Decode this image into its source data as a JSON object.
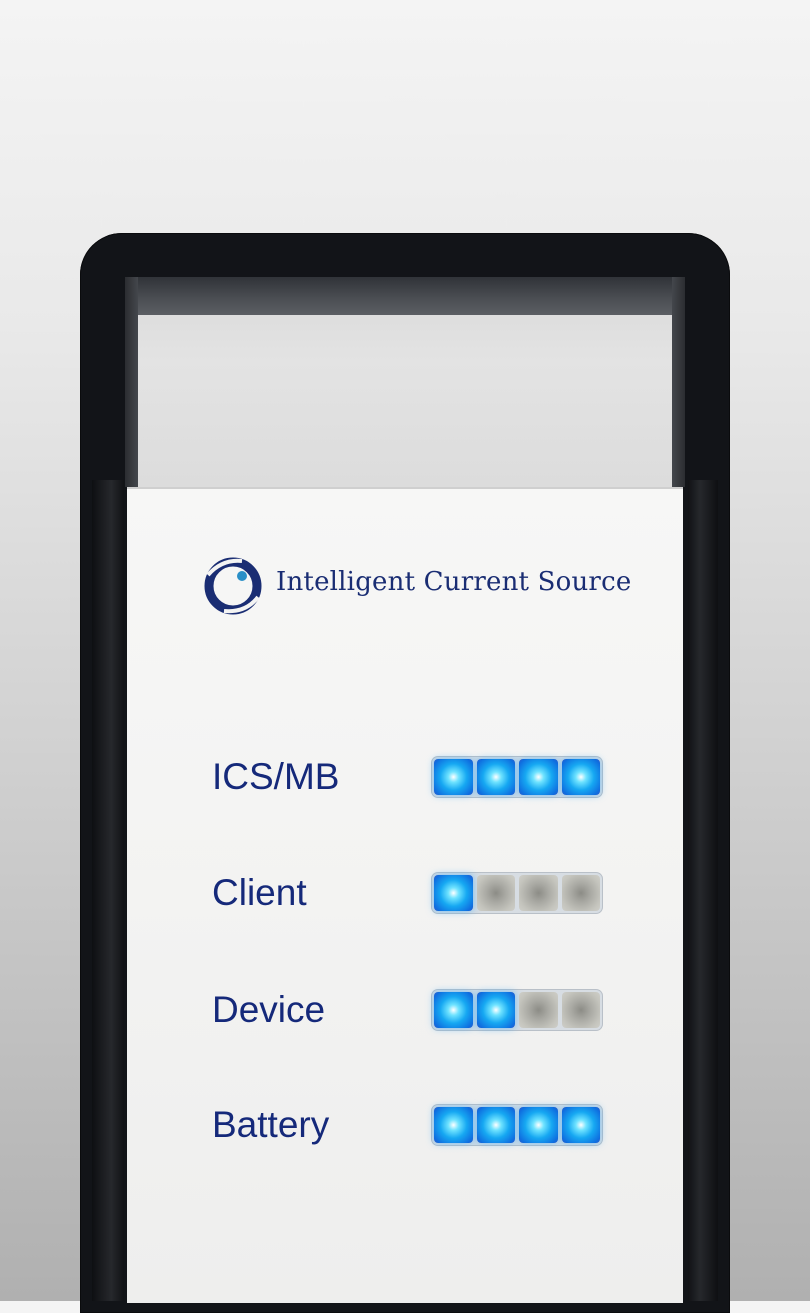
{
  "brand": {
    "name": "Intelligent Current Source",
    "logo": "ics-ring-logo"
  },
  "colors": {
    "brand_blue": "#1a2d73",
    "led_on": "#16a8f2",
    "led_off": "#a8a8a2",
    "frame": "#121418",
    "panel": "#f4f4f3"
  },
  "status_rows": [
    {
      "label": "ICS/MB",
      "leds_on": 4,
      "leds_total": 4
    },
    {
      "label": "Client",
      "leds_on": 1,
      "leds_total": 4
    },
    {
      "label": "Device",
      "leds_on": 2,
      "leds_total": 4
    },
    {
      "label": "Battery",
      "leds_on": 4,
      "leds_total": 4
    }
  ]
}
